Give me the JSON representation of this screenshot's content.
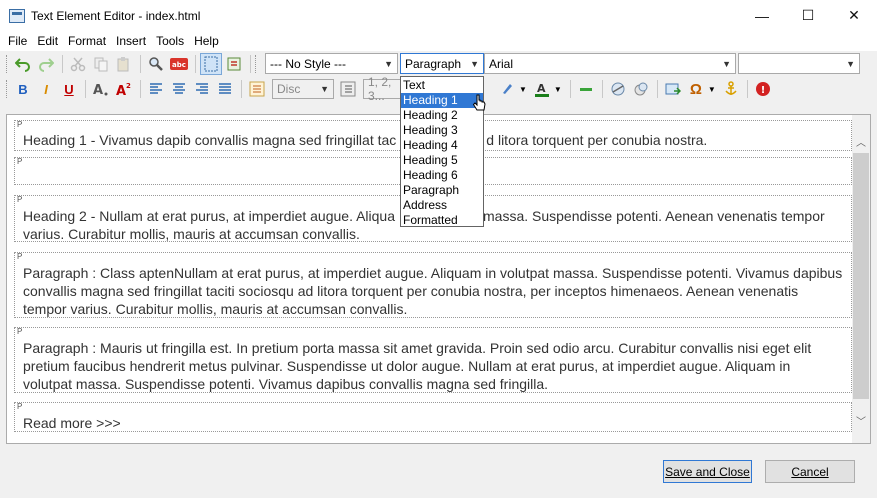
{
  "window": {
    "title": "Text Element Editor - index.html",
    "minimize": "—",
    "maximize": "☐",
    "close": "✕"
  },
  "menu": [
    "File",
    "Edit",
    "Format",
    "Insert",
    "Tools",
    "Help"
  ],
  "toolbar": {
    "style_combo": "--- No Style ---",
    "format_combo": "Paragraph",
    "font_combo": "Arial",
    "size_combo": "",
    "list_bullet_combo": "Disc",
    "list_number_combo": "1, 2, 3...",
    "bold": "B",
    "italic": "I",
    "underline": "U"
  },
  "format_dropdown": {
    "options": [
      "Text",
      "Heading 1",
      "Heading 2",
      "Heading 3",
      "Heading 4",
      "Heading 5",
      "Heading 6",
      "Paragraph",
      "Address",
      "Formatted"
    ],
    "highlighted": "Heading 1"
  },
  "editor": {
    "tag_label": "P",
    "blocks": [
      "Heading 1 - Vivamus dapib convallis magna sed fringillat tac",
      "",
      "Heading 2 - Nullam at erat purus, at imperdiet augue. Aliqua",
      "Paragraph : Class aptenNullam at erat purus, at imperdiet augue. Aliquam in volutpat massa. Suspendisse potenti. Vivamus dapibus convallis magna sed fringillat taciti sociosqu ad litora torquent per conubia nostra, per inceptos himenaeos. Aenean venenatis tempor varius. Curabitur mollis, mauris at accumsan convallis.",
      "Paragraph : Mauris ut fringilla est. In pretium porta massa sit amet gravida. Proin sed odio arcu. Curabitur convallis nisi eget elit pretium faucibus hendrerit metus pulvinar. Suspendisse ut dolor augue. Nullam at erat purus, at imperdiet augue. Aliquam in volutpat massa. Suspendisse potenti. Vivamus dapibus convallis magna sed fringilla.",
      "Read more >>>"
    ],
    "block1_tail": "d litora torquent per conubia nostra.",
    "block3_tail": "massa. Suspendisse potenti. Aenean venenatis tempor",
    "block3_line2": "varius. Curabitur mollis, mauris at accumsan convallis."
  },
  "buttons": {
    "save": "Save and Close",
    "cancel": "Cancel"
  },
  "colors": {
    "accent": "#3078d4",
    "undo": "#4a9a2a",
    "bold": "#1f5fbf",
    "italic": "#d98c00",
    "underline": "#c00000"
  }
}
